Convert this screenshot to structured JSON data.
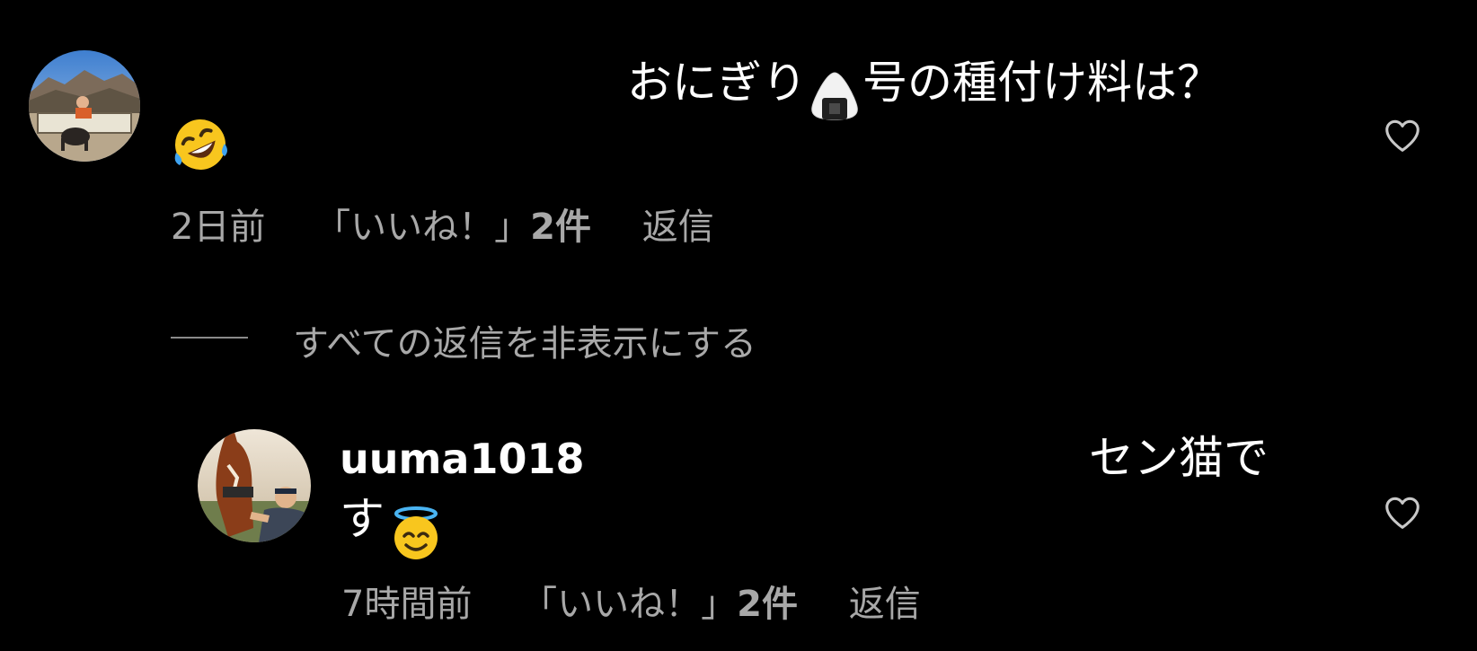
{
  "comment": {
    "text_before_emoji": "おにぎり",
    "text_after_emoji": "号の種付け料は？",
    "emoji_inline": "onigiri-emoji",
    "emoji_trailing": "rofl-emoji",
    "time": "2日前",
    "likes_prefix": "「いいね！」",
    "likes_count": "2件",
    "reply_label": "返信"
  },
  "hide_replies": {
    "label": "すべての返信を非表示にする"
  },
  "reply": {
    "username": "uuma1018",
    "text_line1": "セン猫で",
    "text_line2": "す",
    "emoji_trailing": "halo-smile-emoji",
    "time": "7時間前",
    "likes_prefix": "「いいね！」",
    "likes_count": "2件",
    "reply_label": "返信"
  },
  "icons": {
    "like": "heart-outline-icon"
  },
  "colors": {
    "background": "#000000",
    "text": "#ffffff",
    "secondary": "#a8a8a8"
  }
}
